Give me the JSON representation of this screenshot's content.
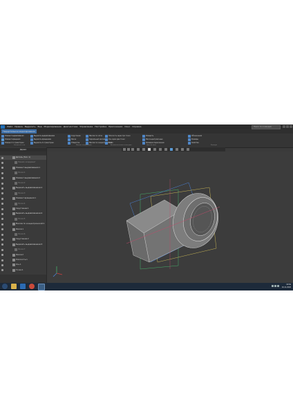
{
  "menubar": {
    "items": [
      "Файл",
      "Правка",
      "Выделить",
      "Вид",
      "Моделирование",
      "Диагностика",
      "Управление",
      "Настройка",
      "Приложения",
      "Окно",
      "Справка"
    ],
    "search_placeholder": "Поиск по командам"
  },
  "tabs": [
    "Твердотельное моделирование"
  ],
  "ribbon": {
    "groups": [
      {
        "labels": [
          "Элемент выдавливания",
          "Элемент вращения",
          "Элемент по траектории"
        ]
      },
      {
        "labels": [
          "Вырезать выдавливанием",
          "Вырезать вращением",
          "Вырезать по траектории"
        ]
      },
      {
        "labels": [
          "Скругление",
          "Фаска",
          "Отверстие"
        ]
      },
      {
        "labels": [
          "Массив по сетке",
          "Зеркальный массив",
          "Массив по концентрической"
        ]
      },
      {
        "labels": [
          "Плоскость через три точки",
          "Ось через две точки",
          "Точка"
        ]
      },
      {
        "labels": [
          "Измерить",
          "Масса-центровочные",
          "Проверка пересечения"
        ]
      },
      {
        "labels": [
          "Обозначения",
          "Размеры",
          "Свойства"
        ]
      }
    ],
    "footer_labels": [
      "Элементы тела",
      "Массив, копирование",
      "Вспомогательная геометрия",
      "Диагностика",
      "Размеры"
    ]
  },
  "left_panel": {
    "title": "Дерево",
    "tree": [
      {
        "label": "Деталь (Тел. 1)",
        "type": "root"
      },
      {
        "label": "Начало координат",
        "type": "sub"
      },
      {
        "label": "Элемент выдавливания:1",
        "type": "item"
      },
      {
        "label": "Эскиз:1",
        "type": "sub"
      },
      {
        "label": "Элемент выдавливания:2",
        "type": "item"
      },
      {
        "label": "Эскиз:2",
        "type": "sub"
      },
      {
        "label": "Вырезать выдавливанием:1",
        "type": "item"
      },
      {
        "label": "Эскиз:3",
        "type": "sub"
      },
      {
        "label": "Элемент вращения:1",
        "type": "item"
      },
      {
        "label": "Эскиз:4",
        "type": "sub"
      },
      {
        "label": "Скругление:1",
        "type": "item"
      },
      {
        "label": "Вырезать выдавливанием:2",
        "type": "item"
      },
      {
        "label": "Эскиз:5",
        "type": "sub"
      },
      {
        "label": "Массив по концентрической:1",
        "type": "item"
      },
      {
        "label": "Фаска:1",
        "type": "item"
      },
      {
        "label": "Эскиз:6",
        "type": "sub"
      },
      {
        "label": "Скругление:2",
        "type": "item"
      },
      {
        "label": "Вырезать выдавливанием:3",
        "type": "item"
      },
      {
        "label": "Эскиз:7",
        "type": "sub"
      },
      {
        "label": "Фаска:2",
        "type": "item"
      },
      {
        "label": "Плоскость:1",
        "type": "item"
      },
      {
        "label": "Ось:1",
        "type": "item"
      },
      {
        "label": "Точка:1",
        "type": "item"
      }
    ]
  },
  "taskbar": {
    "time": "09:56",
    "date": "16.11.2020"
  },
  "colors": {
    "accent": "#3d6ea6",
    "taskbar": "#1d2a3a",
    "viewport": "#3c3c3c"
  }
}
